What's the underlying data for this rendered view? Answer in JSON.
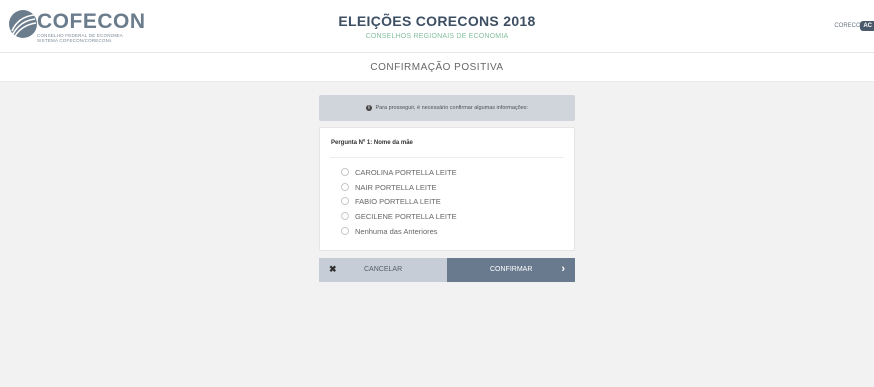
{
  "header": {
    "logo_text": "COFECON",
    "logo_sub1": "CONSELHO FEDERAL DE ECONOMIA",
    "logo_sub2": "SISTEMA COFECON/CORECONs",
    "title": "ELEIÇÕES CORECONS 2018",
    "subtitle": "CONSELHOS REGIONAIS DE ECONOMIA",
    "corecon_label": "CORECON",
    "corecon_badge": "AC"
  },
  "page": {
    "section_title": "CONFIRMAÇÃO POSITIVA",
    "info_message": "Para prosseguir, é necessário confirmar algumas informações:"
  },
  "question": {
    "label": "Pergunta Nº 1: Nome da mãe",
    "options": [
      "CAROLINA PORTELLA LEITE",
      "NAIR PORTELLA LEITE",
      "FABIO PORTELLA LEITE",
      "GECILENE PORTELLA LEITE",
      "Nenhuma das Anteriores"
    ]
  },
  "actions": {
    "cancel_label": "CANCELAR",
    "confirm_label": "CONFIRMAR"
  },
  "icons": {
    "info": "info-circle-icon",
    "cancel": "close-icon",
    "confirm": "chevron-right-icon"
  },
  "colors": {
    "title": "#3d4f63",
    "subtitle": "#86c0a0",
    "cancel_bg": "#c6cdd6",
    "confirm_bg": "#6a7a8e",
    "info_bg": "#d0d5dc"
  }
}
